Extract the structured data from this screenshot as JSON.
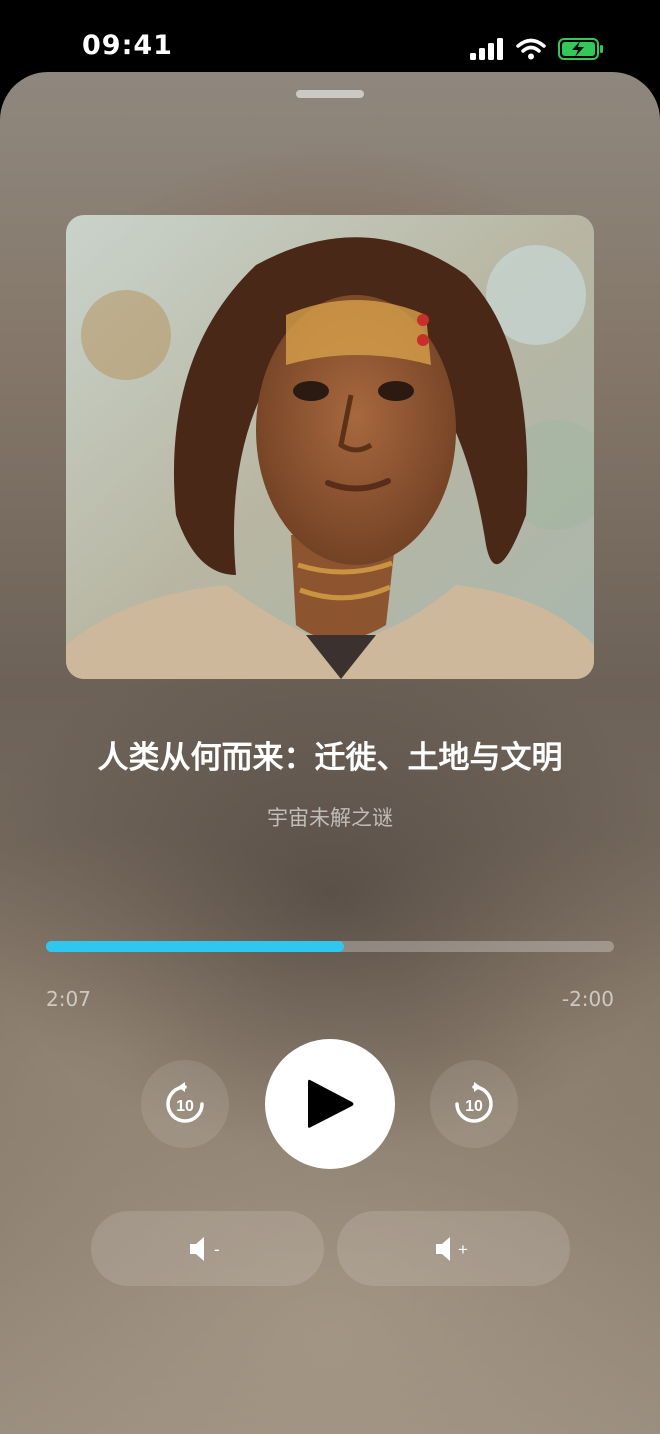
{
  "status": {
    "time": "09:41",
    "icons": [
      "signal-icon",
      "wifi-icon",
      "battery-charging-icon"
    ],
    "battery_color": "#34c759"
  },
  "player": {
    "title": "人类从何而来：迁徙、土地与文明",
    "subtitle": "宇宙未解之谜",
    "progress_fraction": 0.524,
    "elapsed": "2:07",
    "remaining": "-2:00",
    "skip_back_label": "10",
    "skip_forward_label": "10",
    "accent_color": "#2fc7f0",
    "volume_down_symbol": "-",
    "volume_up_symbol": "+"
  }
}
